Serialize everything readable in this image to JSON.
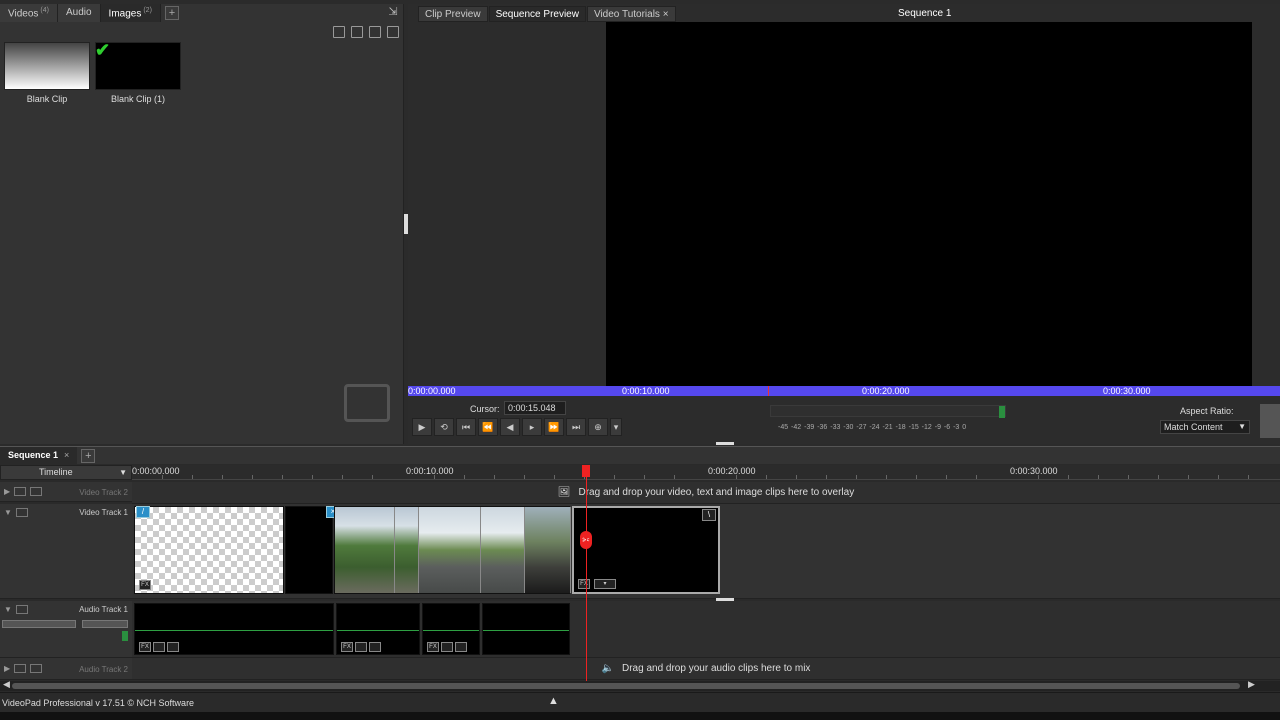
{
  "bin": {
    "tabs": [
      {
        "label": "Videos",
        "count": "(4)"
      },
      {
        "label": "Audio",
        "count": ""
      },
      {
        "label": "Images",
        "count": "(2)"
      }
    ],
    "add_tab": "+",
    "clips": [
      {
        "name": "Blank Clip"
      },
      {
        "name": "Blank Clip (1)"
      }
    ]
  },
  "preview": {
    "tabs": [
      {
        "label": "Clip Preview"
      },
      {
        "label": "Sequence Preview"
      },
      {
        "label": "Video Tutorials",
        "close": "×"
      }
    ],
    "title": "Sequence 1",
    "ruler": [
      "0:00:00.000",
      "0:00:10.000",
      "0:00:20.000",
      "0:00:30.000"
    ],
    "cursor_label": "Cursor:",
    "cursor_value": "0:00:15.048",
    "meter_labels": "-45 -42 -39 -36 -33 -30 -27 -24 -21 -18 -15 -12 -9 -6 -3 0",
    "aspect_label": "Aspect Ratio:",
    "aspect_value": "Match Content"
  },
  "timeline": {
    "sequence_tab": "Sequence 1",
    "sequence_close": "×",
    "add_tab": "+",
    "header": "Timeline",
    "ruler": [
      "0:00:00.000",
      "0:00:10.000",
      "0:00:20.000",
      "0:00:30.000"
    ],
    "tracks": {
      "video2": "Video Track 2",
      "video1": "Video Track 1",
      "audio1": "Audio Track 1",
      "audio2": "Audio Track 2"
    },
    "video_overlay_msg": "Drag and drop your video, text and image clips here to overlay",
    "audio_mix_msg": "Drag and drop your audio clips here to mix",
    "fx_label": "FX"
  },
  "status": {
    "text": "VideoPad Professional v 17.51 © NCH Software"
  },
  "colors": {
    "accent_blue": "#5548ee",
    "playhead_red": "#e22222",
    "meter_green": "#2a8f3f"
  }
}
